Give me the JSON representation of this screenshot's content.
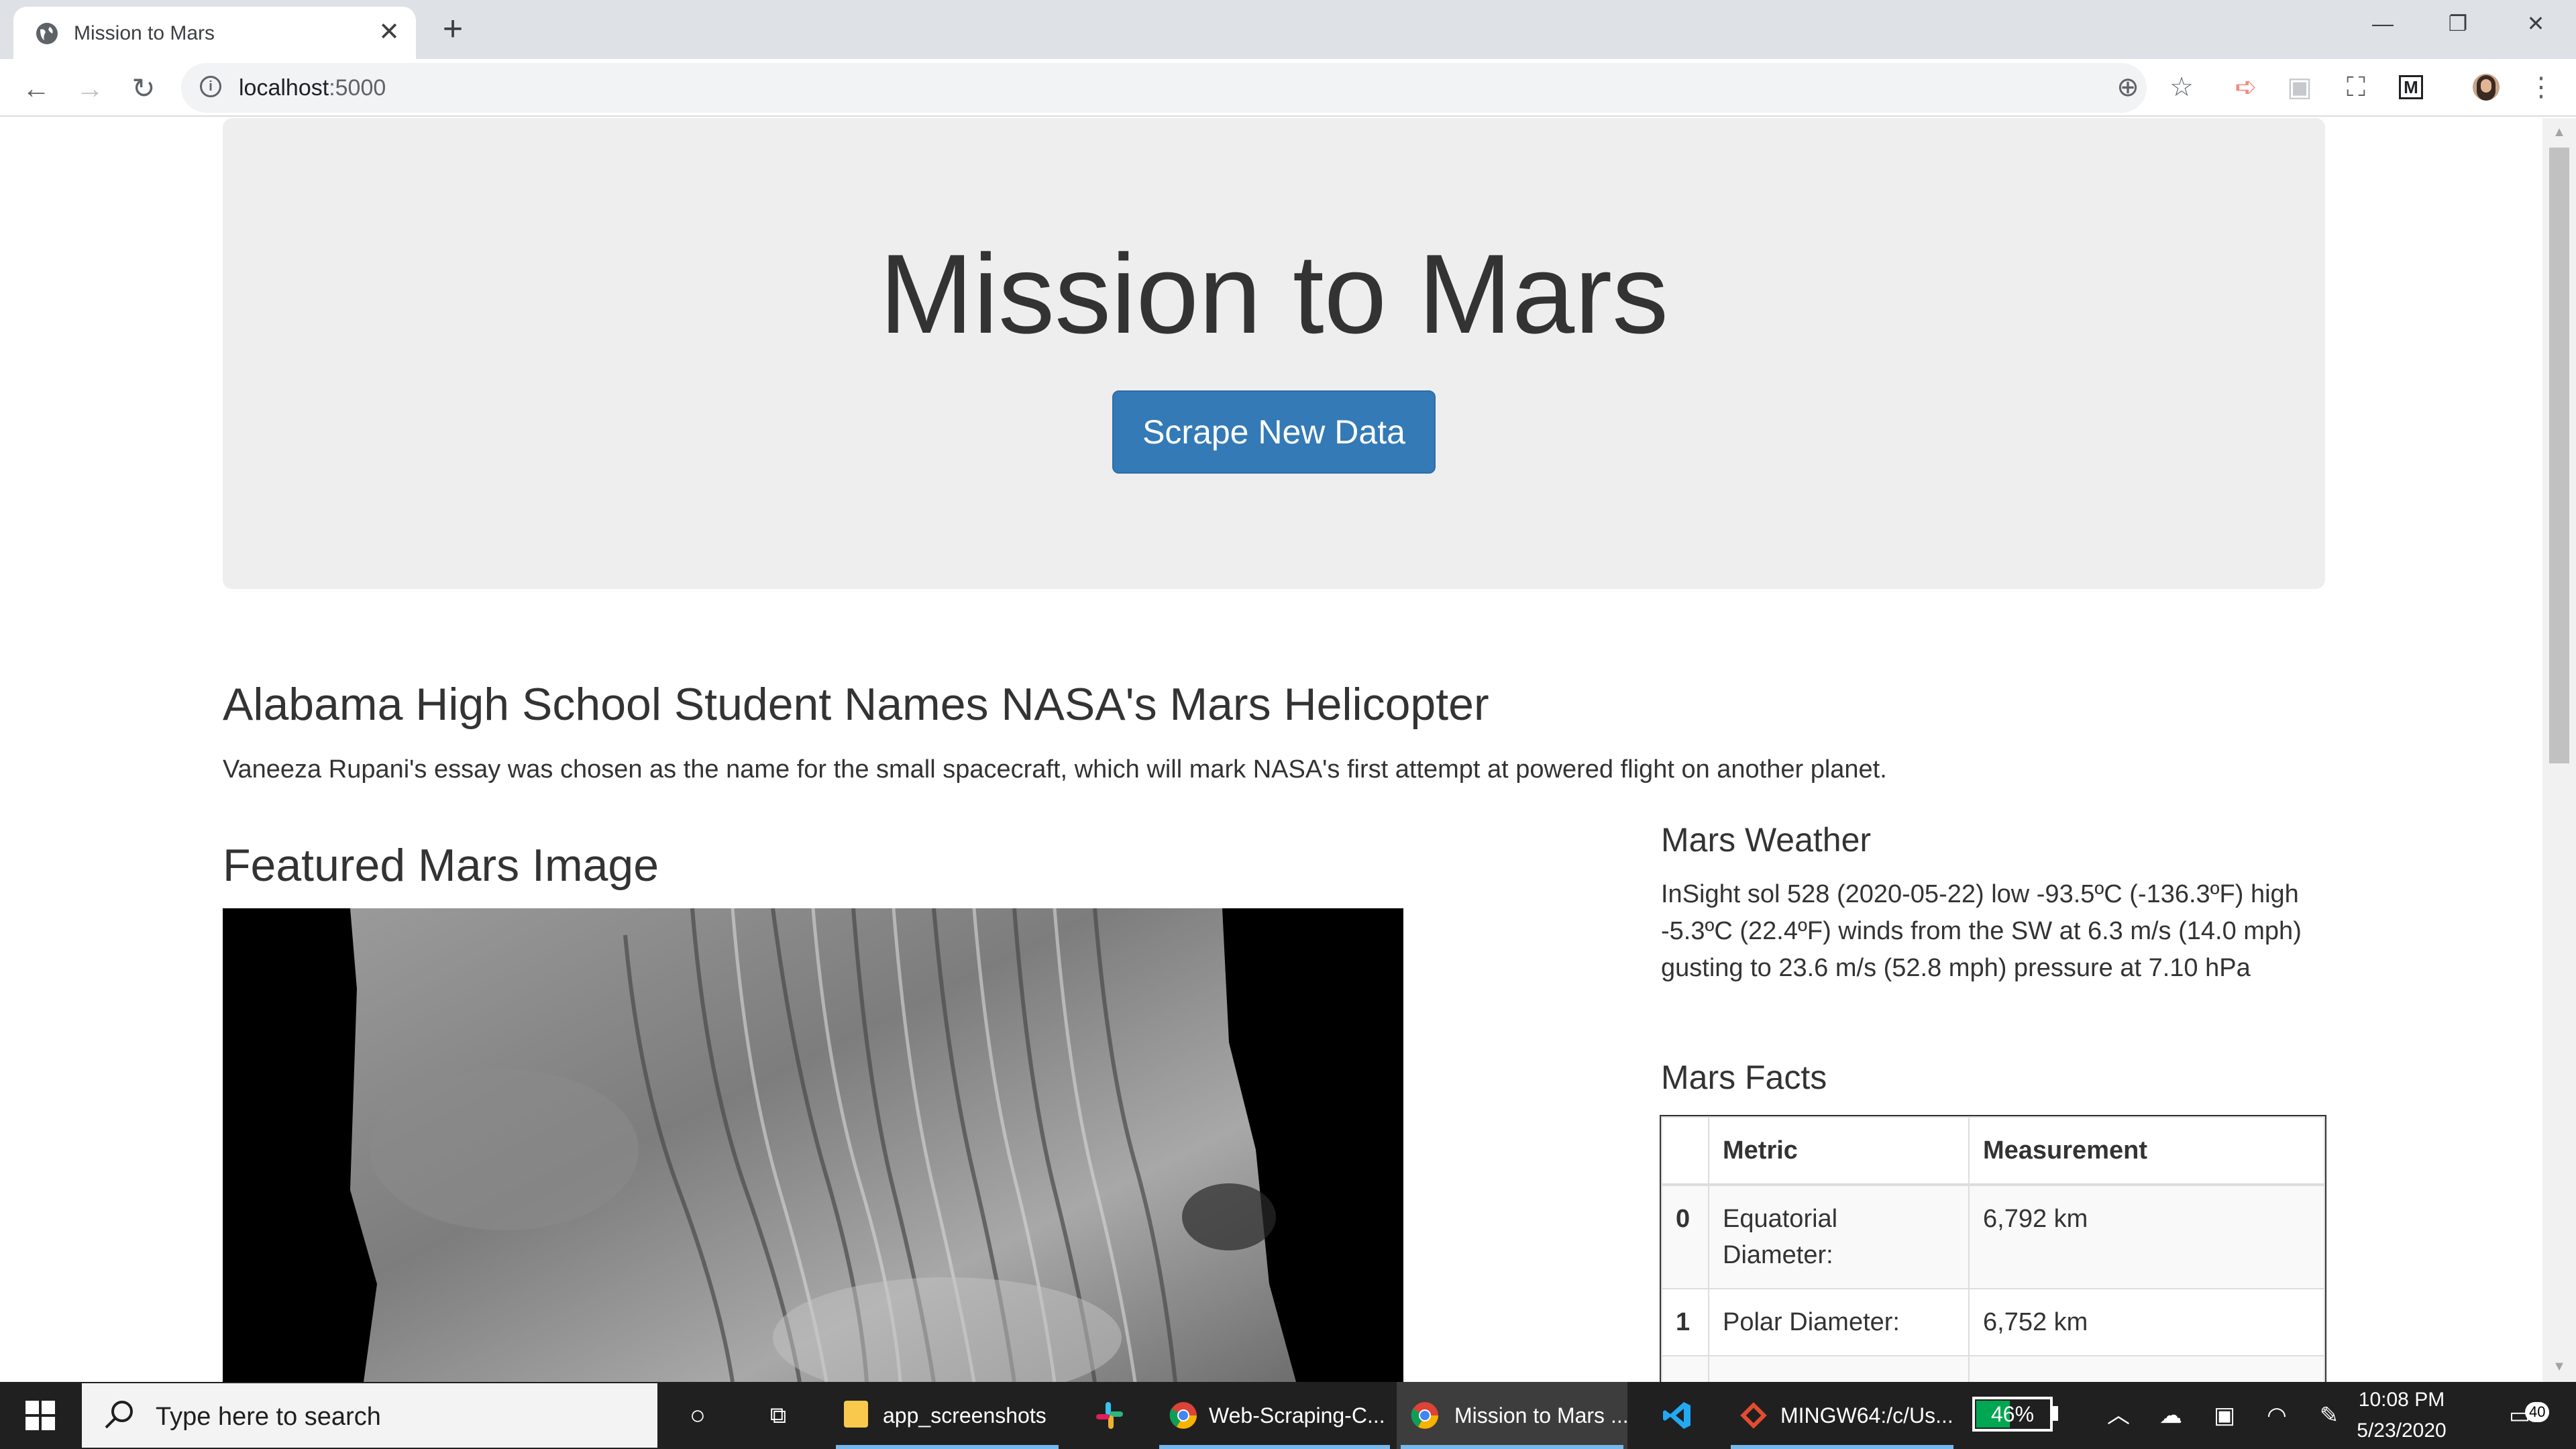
{
  "browser": {
    "tab_title": "Mission to Mars",
    "tab_close": "✕",
    "new_tab": "+",
    "url_host": "localhost",
    "url_port": ":5000",
    "window": {
      "minimize": "—",
      "restore": "❐",
      "close": "✕"
    }
  },
  "page": {
    "heading": "Mission to Mars",
    "scrape_button": "Scrape New Data",
    "news_title": "Alabama High School Student Names NASA's Mars Helicopter",
    "news_paragraph": "Vaneeza Rupani's essay was chosen as the name for the small spacecraft, which will mark NASA's first attempt at powered flight on another planet.",
    "featured_title": "Featured Mars Image",
    "weather_title": "Mars Weather",
    "weather_text": "InSight sol 528 (2020-05-22) low -93.5ºC (-136.3ºF) high -5.3ºC (22.4ºF) winds from the SW at 6.3 m/s (14.0 mph) gusting to 23.6 m/s (52.8 mph) pressure at 7.10 hPa",
    "facts_title": "Mars Facts",
    "facts": {
      "headers": [
        "",
        "Metric",
        "Measurement"
      ],
      "rows": [
        [
          "0",
          "Equatorial Diameter:",
          "6,792 km"
        ],
        [
          "1",
          "Polar Diameter:",
          "6,752 km"
        ]
      ]
    }
  },
  "taskbar": {
    "search_placeholder": "Type here to search",
    "apps": [
      {
        "label": "app_screenshots",
        "icon": "folder-icon"
      },
      {
        "label": "",
        "icon": "slack-icon"
      },
      {
        "label": "Web-Scraping-C...",
        "icon": "chrome-icon"
      },
      {
        "label": "Mission to Mars ...",
        "icon": "chrome-icon"
      },
      {
        "label": "",
        "icon": "vscode-icon"
      },
      {
        "label": "MINGW64:/c/Us...",
        "icon": "git-bash-icon"
      }
    ],
    "battery_percent": 46,
    "battery_label": "46%",
    "time": "10:08 PM",
    "date": "5/23/2020",
    "notification_count": "40"
  }
}
